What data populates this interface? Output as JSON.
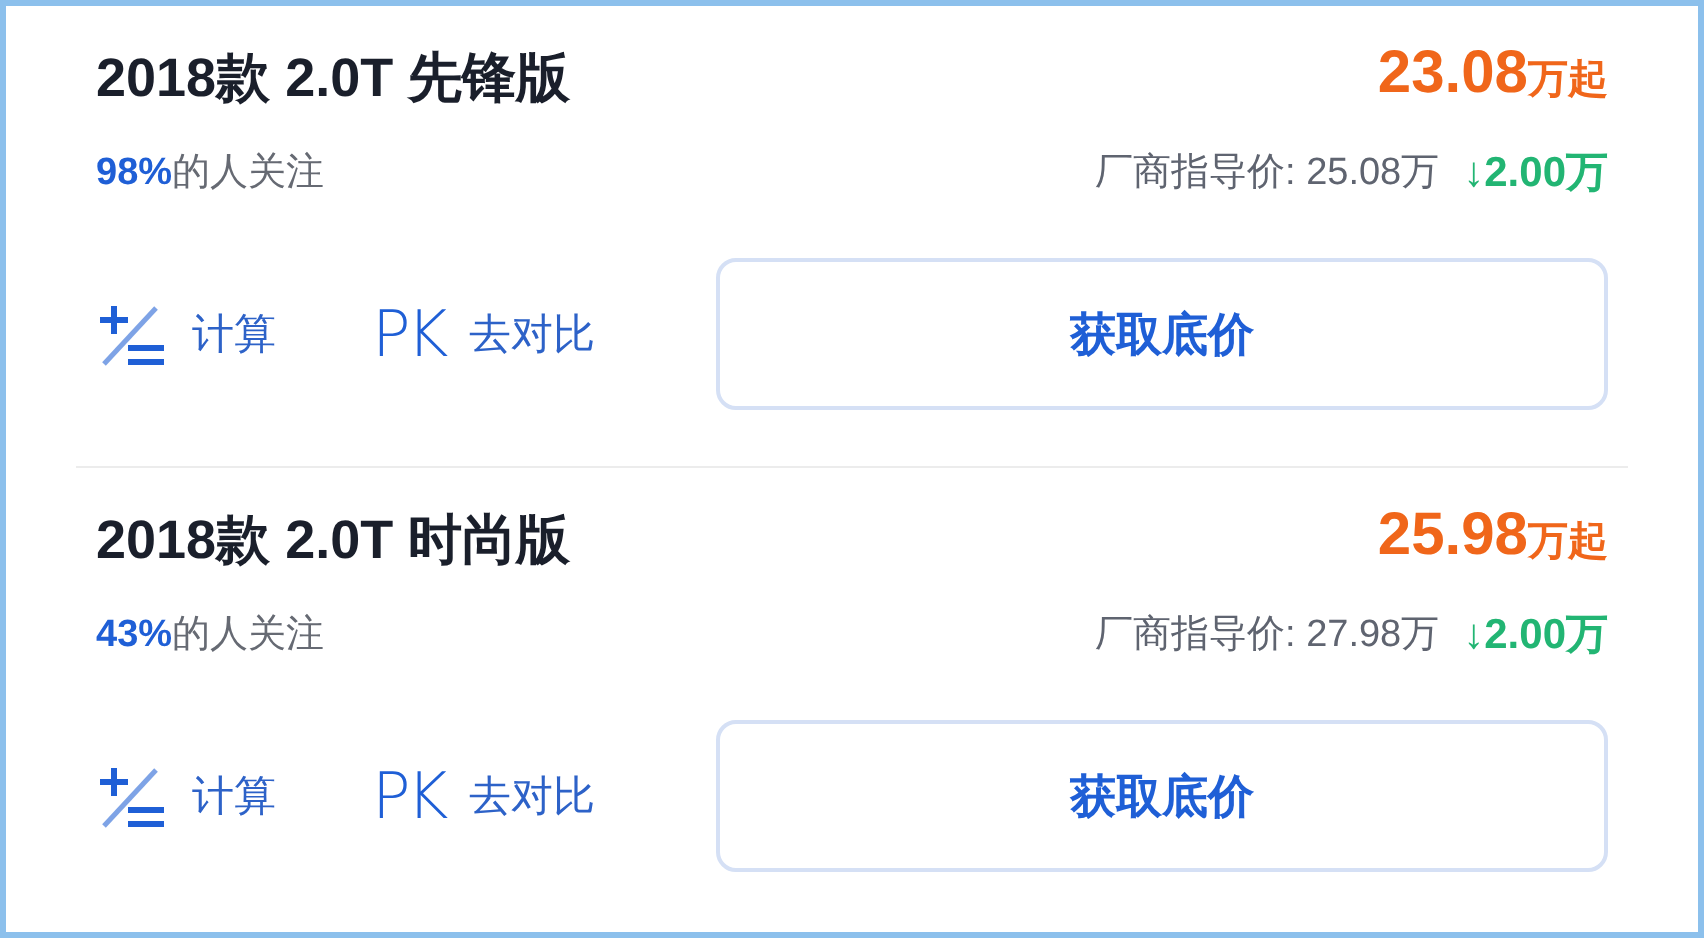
{
  "cards": [
    {
      "title": "2018款 2.0T 先锋版",
      "attention_pct": "98%",
      "attention_text": "的人关注",
      "price": "23.08",
      "price_unit": "万起",
      "msrp": "厂商指导价: 25.08万",
      "drop": "↓2.00万",
      "actions": [
        {
          "kind": "calc",
          "label": "计算"
        },
        {
          "kind": "pk",
          "icon_text": "PK",
          "label": "去对比"
        }
      ],
      "button": "获取底价"
    },
    {
      "title": "2018款 2.0T 时尚版",
      "attention_pct": "43%",
      "attention_text": "的人关注",
      "price": "25.98",
      "price_unit": "万起",
      "msrp": "厂商指导价: 27.98万",
      "drop": "↓2.00万",
      "actions": [
        {
          "kind": "calc",
          "label": "计算"
        },
        {
          "kind": "pk",
          "icon_text": "PK",
          "label": "去对比"
        }
      ],
      "button": "获取底价"
    }
  ]
}
